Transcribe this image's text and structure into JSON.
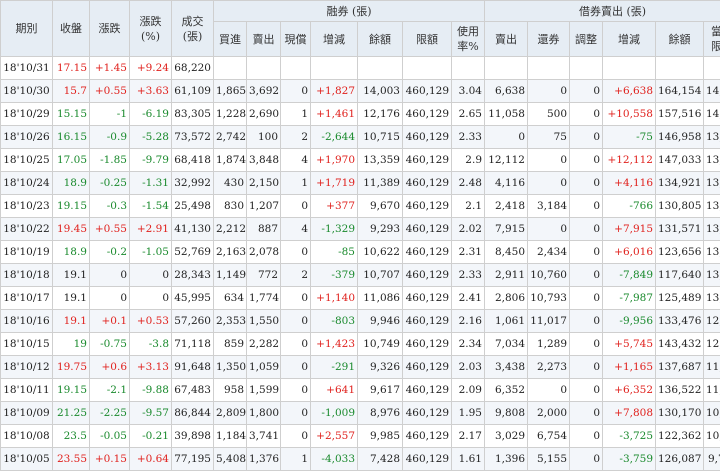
{
  "colors": {
    "up": "#e0211d",
    "down": "#1a8a2d",
    "header_bg": "#e6edf4",
    "alt_row_bg": "#f3f6fa"
  },
  "headers": {
    "date": "期別",
    "close": "收盤",
    "change": "漲跌",
    "change_pct": "漲跌\n(%)",
    "volume": "成交\n(張)",
    "margin_group": "融券 (張)",
    "short_group": "借券賣出 (張)",
    "margin_cols": [
      "買進",
      "賣出",
      "現償",
      "增減",
      "餘額",
      "限額",
      "使用\n率%"
    ],
    "short_cols": [
      "賣出",
      "還券",
      "調整",
      "增減",
      "餘額",
      "當日\n限額"
    ]
  },
  "rows": [
    [
      "18'10/31",
      "17.15",
      "+1.45",
      "+9.24",
      "68,220",
      "",
      "",
      "",
      "",
      "",
      "",
      "",
      "",
      "",
      "",
      "",
      "",
      ""
    ],
    [
      "18'10/30",
      "15.7",
      "+0.55",
      "+3.63",
      "61,109",
      "1,865",
      "3,692",
      "0",
      "+1,827",
      "14,003",
      "460,129",
      "3.04",
      "6,638",
      "0",
      "0",
      "+6,638",
      "164,154",
      "14,893"
    ],
    [
      "18'10/29",
      "15.15",
      "-1",
      "-6.19",
      "83,305",
      "1,228",
      "2,690",
      "1",
      "+1,461",
      "12,176",
      "460,129",
      "2.65",
      "11,058",
      "500",
      "0",
      "+10,558",
      "157,516",
      "14,564"
    ],
    [
      "18'10/26",
      "16.15",
      "-0.9",
      "-5.28",
      "73,572",
      "2,742",
      "100",
      "2",
      "-2,644",
      "10,715",
      "460,129",
      "2.33",
      "0",
      "75",
      "0",
      "-75",
      "146,958",
      "13,994"
    ],
    [
      "18'10/25",
      "17.05",
      "-1.85",
      "-9.79",
      "68,418",
      "1,874",
      "3,848",
      "4",
      "+1,970",
      "13,359",
      "460,129",
      "2.9",
      "12,112",
      "0",
      "0",
      "+12,112",
      "147,033",
      "13,617"
    ],
    [
      "18'10/24",
      "18.9",
      "-0.25",
      "-1.31",
      "32,992",
      "430",
      "2,150",
      "1",
      "+1,719",
      "11,389",
      "460,129",
      "2.48",
      "4,116",
      "0",
      "0",
      "+4,116",
      "134,921",
      "13,287"
    ],
    [
      "18'10/23",
      "19.15",
      "-0.3",
      "-1.54",
      "25,498",
      "830",
      "1,207",
      "0",
      "+377",
      "9,670",
      "460,129",
      "2.1",
      "2,418",
      "3,184",
      "0",
      "-766",
      "130,805",
      "13,503"
    ],
    [
      "18'10/22",
      "19.45",
      "+0.55",
      "+2.91",
      "41,130",
      "2,212",
      "887",
      "4",
      "-1,329",
      "9,293",
      "460,129",
      "2.02",
      "7,915",
      "0",
      "0",
      "+7,915",
      "131,571",
      "13,856"
    ],
    [
      "18'10/19",
      "18.9",
      "-0.2",
      "-1.05",
      "52,769",
      "2,163",
      "2,078",
      "0",
      "-85",
      "10,622",
      "460,129",
      "2.31",
      "8,450",
      "2,434",
      "0",
      "+6,016",
      "123,656",
      "13,770"
    ],
    [
      "18'10/18",
      "19.1",
      "0",
      "0",
      "28,343",
      "1,149",
      "772",
      "2",
      "-379",
      "10,707",
      "460,129",
      "2.33",
      "2,911",
      "10,760",
      "0",
      "-7,849",
      "117,640",
      "13,482"
    ],
    [
      "18'10/17",
      "19.1",
      "0",
      "0",
      "45,995",
      "634",
      "1,774",
      "0",
      "+1,140",
      "11,086",
      "460,129",
      "2.41",
      "2,806",
      "10,793",
      "0",
      "-7,987",
      "125,489",
      "13,316"
    ],
    [
      "18'10/16",
      "19.1",
      "+0.1",
      "+0.53",
      "57,260",
      "2,353",
      "1,550",
      "0",
      "-803",
      "9,946",
      "460,129",
      "2.16",
      "1,061",
      "11,017",
      "0",
      "-9,956",
      "133,476",
      "12,957"
    ],
    [
      "18'10/15",
      "19",
      "-0.75",
      "-3.8",
      "71,118",
      "859",
      "2,282",
      "0",
      "+1,423",
      "10,749",
      "460,129",
      "2.34",
      "7,034",
      "1,289",
      "0",
      "+5,745",
      "143,432",
      "12,503"
    ],
    [
      "18'10/12",
      "19.75",
      "+0.6",
      "+3.13",
      "91,648",
      "1,350",
      "1,059",
      "0",
      "-291",
      "9,326",
      "460,129",
      "2.03",
      "3,438",
      "2,273",
      "0",
      "+1,165",
      "137,687",
      "11,897"
    ],
    [
      "18'10/11",
      "19.15",
      "-2.1",
      "-9.88",
      "67,483",
      "958",
      "1,599",
      "0",
      "+641",
      "9,617",
      "460,129",
      "2.09",
      "6,352",
      "0",
      "0",
      "+6,352",
      "136,522",
      "11,129"
    ],
    [
      "18'10/09",
      "21.25",
      "-2.25",
      "-9.57",
      "86,844",
      "2,809",
      "1,800",
      "0",
      "-1,009",
      "8,976",
      "460,129",
      "1.95",
      "9,808",
      "2,000",
      "0",
      "+7,808",
      "130,170",
      "10,624"
    ],
    [
      "18'10/08",
      "23.5",
      "-0.05",
      "-0.21",
      "39,898",
      "1,184",
      "3,741",
      "0",
      "+2,557",
      "9,985",
      "460,129",
      "2.17",
      "3,029",
      "6,754",
      "0",
      "-3,725",
      "122,362",
      "10,016"
    ],
    [
      "18'10/05",
      "23.55",
      "+0.15",
      "+0.64",
      "77,195",
      "5,408",
      "1,376",
      "1",
      "-4,033",
      "7,428",
      "460,129",
      "1.61",
      "1,396",
      "5,155",
      "0",
      "-3,759",
      "126,087",
      "9,788"
    ]
  ]
}
